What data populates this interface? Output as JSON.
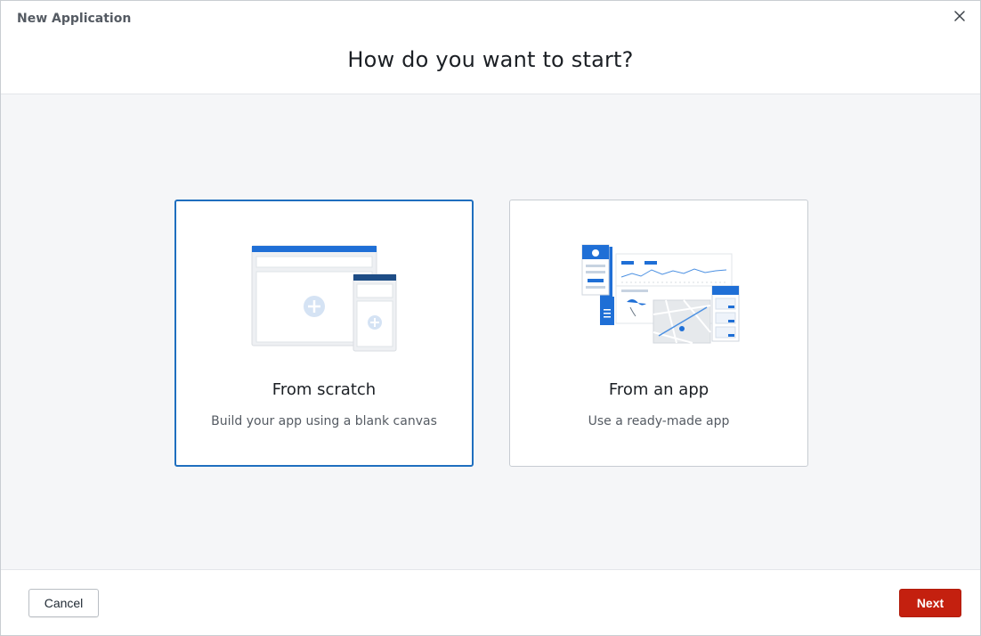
{
  "window": {
    "title": "New Application",
    "close_icon": "close-icon"
  },
  "header": {
    "title": "How do you want to start?"
  },
  "options": [
    {
      "title": "From scratch",
      "subtitle": "Build your app using a blank canvas",
      "selected": true,
      "icon": "blank-canvas-illustration"
    },
    {
      "title": "From an app",
      "subtitle": "Use a ready-made app",
      "selected": false,
      "icon": "ready-made-app-illustration"
    }
  ],
  "footer": {
    "cancel_label": "Cancel",
    "next_label": "Next"
  },
  "colors": {
    "accent": "#1f6fbf",
    "primary_button": "#c4200f",
    "content_bg": "#f5f6f8"
  }
}
